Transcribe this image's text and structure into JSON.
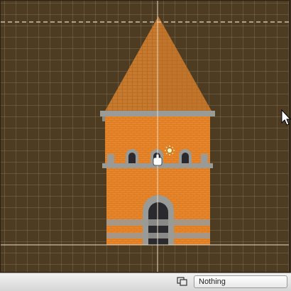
{
  "canvas": {
    "background_color": "#4d3b22",
    "grid_color": "#96825f",
    "guide_color": "#e6dcc8",
    "guides": [
      "horizontal-dashed-top",
      "vertical-center",
      "horizontal-baseline"
    ]
  },
  "tower": {
    "roof_color": "#c77a2e",
    "wall_color": "#e8862a",
    "stone_color": "#9a9a96",
    "window_color": "#2a2a2e"
  },
  "toolbar": {
    "layer_select": "Nothing",
    "layer_button_icon": "overlapping-squares-icon"
  },
  "icons": [
    "hand-cursor-icon",
    "sun-light-icon",
    "arrow-cursor-icon"
  ]
}
